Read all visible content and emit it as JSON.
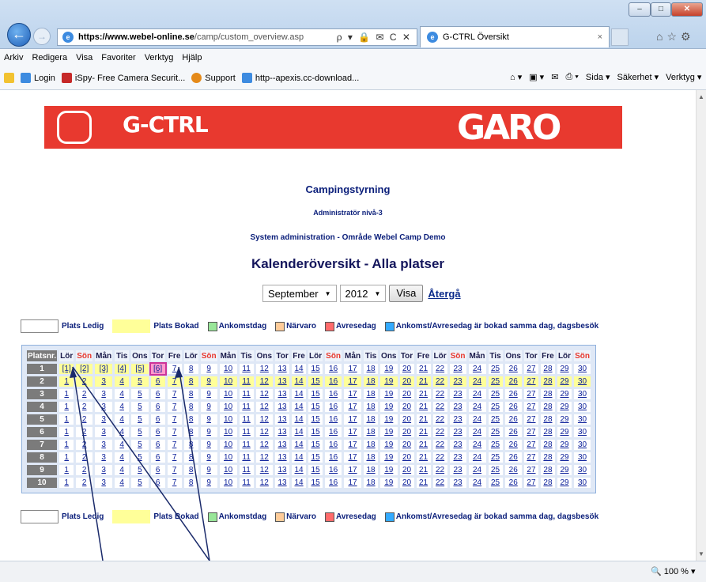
{
  "window": {
    "minimize": "–",
    "maximize": "□",
    "close": "✕"
  },
  "address": {
    "host": "https://www.webel-online.se",
    "path": "/camp/custom_overview.asp",
    "tools": "ρ ▾ 🔒 ✉ C ✕"
  },
  "tab": {
    "title": "G-CTRL Översikt",
    "close": "×"
  },
  "menu": [
    "Arkiv",
    "Redigera",
    "Visa",
    "Favoriter",
    "Verktyg",
    "Hjälp"
  ],
  "favorites": [
    "Login",
    "iSpy- Free Camera Securit...",
    "Support",
    "http--apexis.cc-download..."
  ],
  "command_bar": [
    "Sida ▾",
    "Säkerhet ▾",
    "Verktyg ▾"
  ],
  "banner": {
    "left": "G-CTRL",
    "right": "GARO"
  },
  "headings": {
    "h1": "Campingstyrning",
    "h2": "Administratör nivå-3",
    "h3": "System administration - Område Webel Camp Demo",
    "h4": "Kalenderöversikt - Alla platser"
  },
  "controls": {
    "month": "September",
    "year": "2012",
    "visa": "Visa",
    "back": "Återgå"
  },
  "legend": {
    "free": "Plats Ledig",
    "booked": "Plats Bokad",
    "arrival": "Ankomstdag",
    "presence": "Närvaro",
    "departure": "Avresedag",
    "same_day": "Ankomst/Avresedag är bokad samma dag, dagsbesök"
  },
  "colors": {
    "free": "#ffffff",
    "booked": "#ffff99",
    "arrival": "#99e699",
    "presence": "#ffcc99",
    "departure": "#ff6b6b",
    "same_day": "#33aaff",
    "selected": "#ff99cc"
  },
  "calendar": {
    "corner": "Platsnr.",
    "weekdays": [
      "Lör",
      "Sön",
      "Mån",
      "Tis",
      "Ons",
      "Tor",
      "Fre",
      "Lör",
      "Sön",
      "Mån",
      "Tis",
      "Ons",
      "Tor",
      "Fre",
      "Lör",
      "Sön",
      "Mån",
      "Tis",
      "Ons",
      "Tor",
      "Fre",
      "Lör",
      "Sön",
      "Mån",
      "Tis",
      "Ons",
      "Tor",
      "Fre",
      "Lör",
      "Sön"
    ],
    "sites": [
      "1",
      "2",
      "3",
      "4",
      "5",
      "6",
      "7",
      "8",
      "9",
      "10"
    ],
    "days": [
      "1",
      "2",
      "3",
      "4",
      "5",
      "6",
      "7",
      "8",
      "9",
      "10",
      "11",
      "12",
      "13",
      "14",
      "15",
      "16",
      "17",
      "18",
      "19",
      "20",
      "21",
      "22",
      "23",
      "24",
      "25",
      "26",
      "27",
      "28",
      "29",
      "30"
    ],
    "row1_labels": [
      "[1]",
      "[2]",
      "[3]",
      "[4]",
      "[5]",
      "[6]"
    ]
  },
  "status": {
    "zoom": "100 %"
  }
}
